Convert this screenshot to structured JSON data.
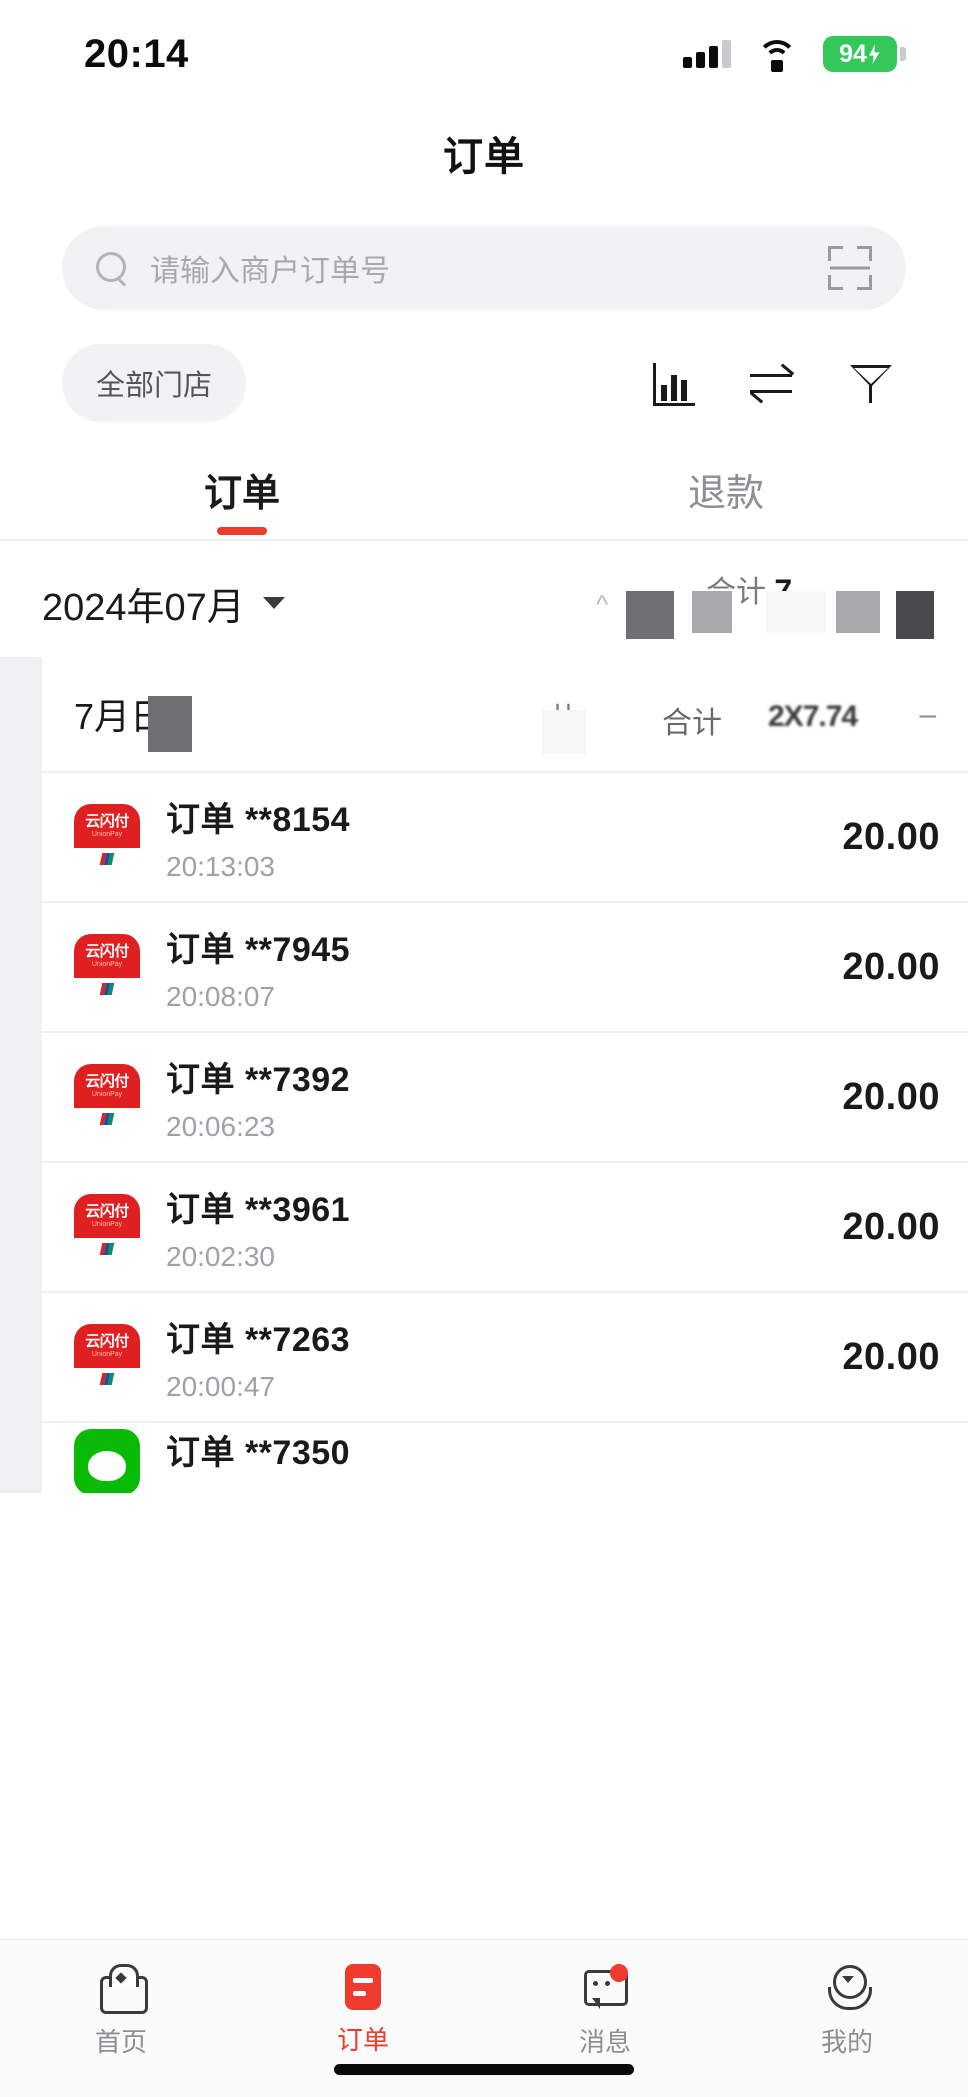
{
  "status_bar": {
    "time": "20:14",
    "signal_icon": "signal-bars-icon",
    "wifi_icon": "wifi-icon",
    "battery_level": "94",
    "battery_charging": true
  },
  "header": {
    "title": "订单"
  },
  "search": {
    "placeholder": "请输入商户订单号",
    "value": "",
    "search_icon": "search-icon",
    "scan_icon": "scan-code-icon"
  },
  "filters": {
    "store_chip": "全部门店",
    "tools": [
      {
        "name": "statistics-icon",
        "label": "统计"
      },
      {
        "name": "transfer-icon",
        "label": "交易"
      },
      {
        "name": "filter-icon",
        "label": "筛选"
      }
    ]
  },
  "tabs": [
    {
      "label": "订单",
      "active": true
    },
    {
      "label": "退款",
      "active": false
    }
  ],
  "month_summary": {
    "month": "2024年07月",
    "caret": "chevron-down-icon",
    "total_label": "合计",
    "total_value": "7",
    "count_prefix": "共",
    "redacted": true
  },
  "day_group": {
    "date": "7月",
    "date_suffix": "日",
    "count_label": "共",
    "total_label": "合计",
    "total_value": "2X7.74",
    "trailing": "–",
    "redacted": true
  },
  "orders": [
    {
      "channel": "unionpay",
      "title": "订单 **8154",
      "time": "20:13:03",
      "amount": "20.00"
    },
    {
      "channel": "unionpay",
      "title": "订单 **7945",
      "time": "20:08:07",
      "amount": "20.00"
    },
    {
      "channel": "unionpay",
      "title": "订单 **7392",
      "time": "20:06:23",
      "amount": "20.00"
    },
    {
      "channel": "unionpay",
      "title": "订单 **3961",
      "time": "20:02:30",
      "amount": "20.00"
    },
    {
      "channel": "unionpay",
      "title": "订单 **7263",
      "time": "20:00:47",
      "amount": "20.00"
    },
    {
      "channel": "wechat",
      "title": "订单 **7350",
      "time": "",
      "amount": ""
    }
  ],
  "pay_icon": {
    "cn": "云闪付",
    "en": "UnionPay"
  },
  "tabbar": [
    {
      "label": "首页",
      "icon": "home-icon",
      "active": false,
      "badge": false
    },
    {
      "label": "订单",
      "icon": "order-document-icon",
      "active": true,
      "badge": false
    },
    {
      "label": "消息",
      "icon": "message-bubble-icon",
      "active": false,
      "badge": true
    },
    {
      "label": "我的",
      "icon": "profile-icon",
      "active": false,
      "badge": false
    }
  ],
  "colors": {
    "accent": "#ee3b2e",
    "battery": "#34c759",
    "bg": "#f0f0f2",
    "wechat": "#09bb07"
  }
}
